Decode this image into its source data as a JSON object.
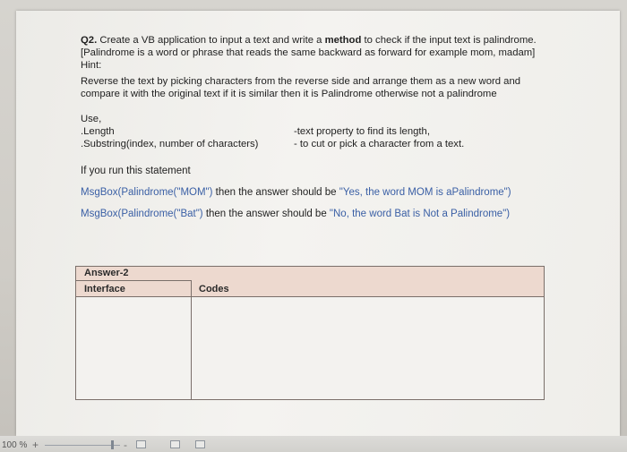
{
  "question": {
    "number": "Q2.",
    "line1_rest": " Create a VB application to input a text and write a ",
    "line1_bold": "method",
    "line1_end": " to check if the input text is palindrome.",
    "line2": "[Palindrome is a word or phrase that reads the same backward as forward for example mom, madam]",
    "hint_label": "Hint:",
    "hint_line1": "Reverse the text by picking characters from the reverse side and arrange them as a new  word and",
    "hint_line2": "compare it with the original text if it is similar then it is Palindrome otherwise not a palindrome"
  },
  "use_section": {
    "label": "Use,",
    "item1": ".Length",
    "item2": ".Substring(index, number of characters)",
    "desc1": "-text property to find its length,",
    "desc2": "- to cut or pick  a character from a text."
  },
  "run_statement": "If you run this statement",
  "examples": [
    {
      "call": "MsgBox(Palindrome(\"MOM\")",
      "middle": " then the answer should be ",
      "result": "\"Yes, the word MOM is aPalindrome\")"
    },
    {
      "call": "MsgBox(Palindrome(\"Bat\")",
      "middle": " then the answer should be ",
      "result": "\"No, the word Bat is Not a Palindrome\")"
    }
  ],
  "answer_table": {
    "title": "Answer-2",
    "col1": "Interface",
    "col2": "Codes"
  },
  "status_bar": {
    "zoom": "100 %",
    "plus": "+",
    "minus": "-"
  },
  "colors": {
    "example_blue": "#3a5fa5",
    "table_header_bg": "#edd9cf"
  }
}
